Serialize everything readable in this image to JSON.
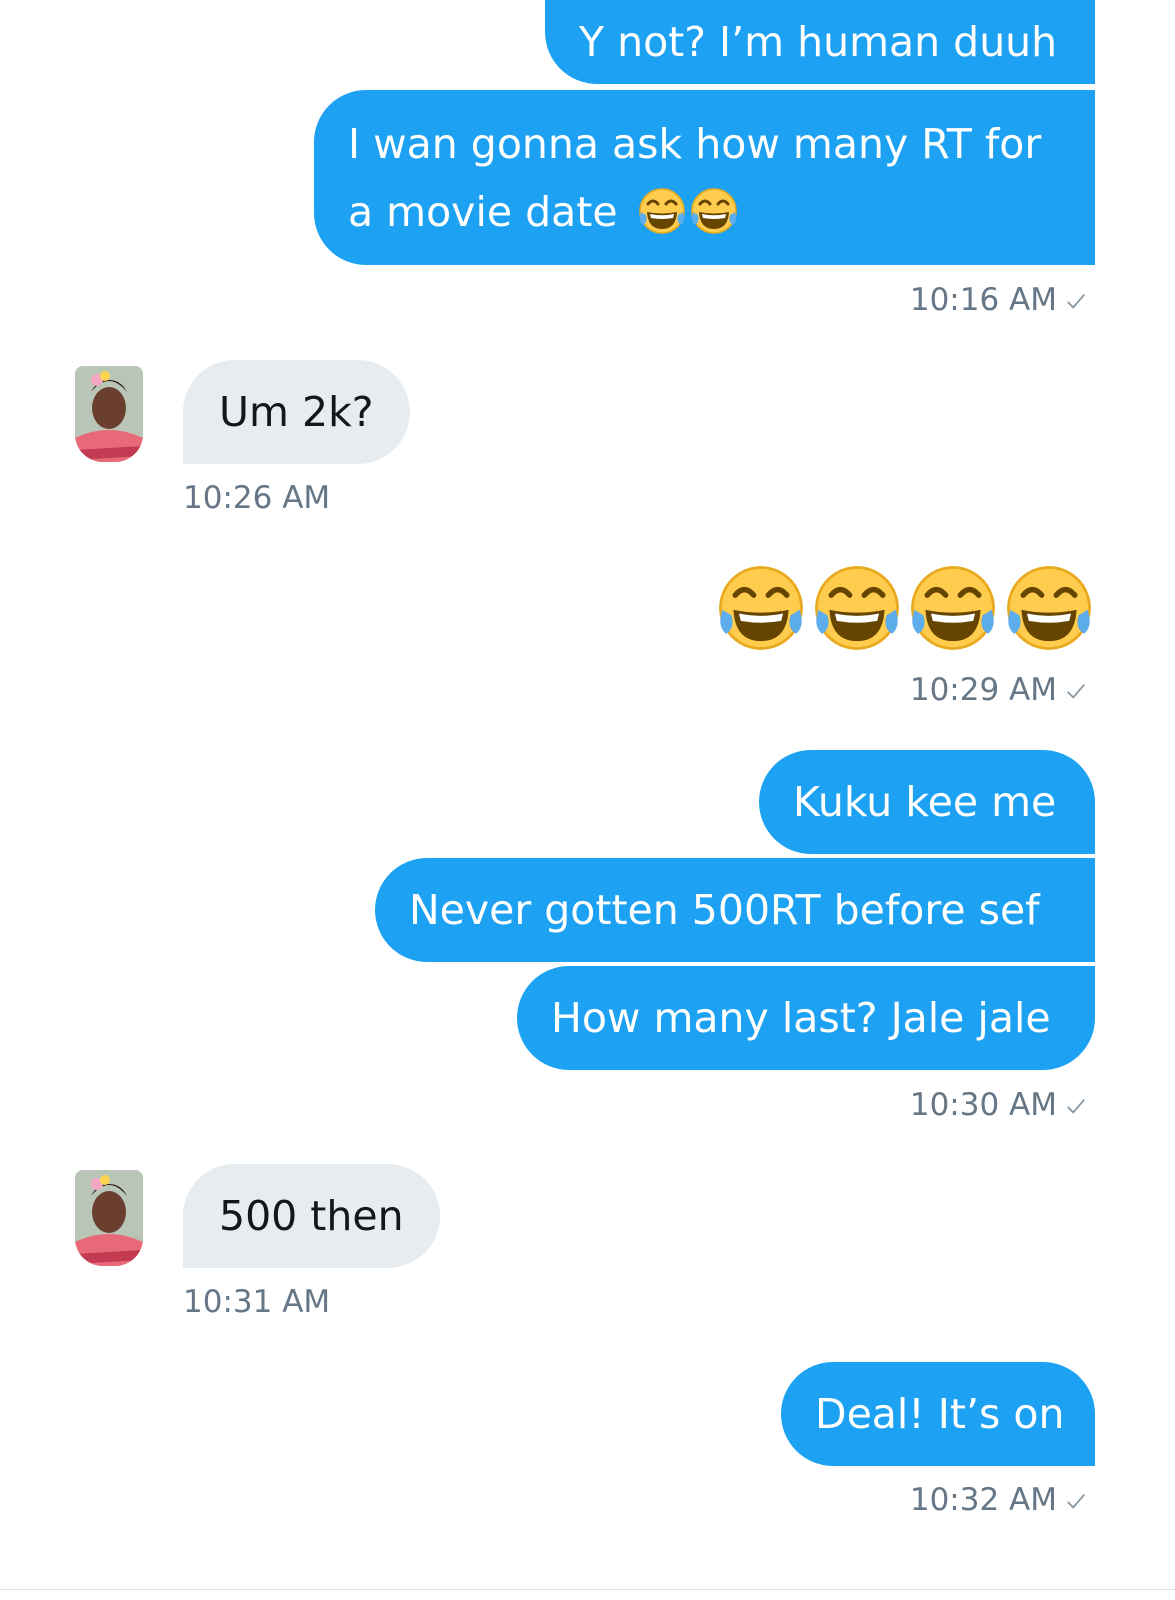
{
  "messages": {
    "m1": "Y not? I’m human duuh",
    "m2_line1": "I wan gonna ask how many RT for",
    "m2_line2": "a movie date",
    "t1": "10:16 AM",
    "r1": "Um 2k?",
    "rt1": "10:26 AM",
    "t2": "10:29 AM",
    "m3": "Kuku kee me",
    "m4": "Never gotten 500RT before sef",
    "m5": "How many last? Jale jale",
    "t3": "10:30 AM",
    "r2": "500 then",
    "rt2": "10:31 AM",
    "m6": "Deal! It’s on",
    "t4": "10:32 AM"
  },
  "icons": {
    "emoji": "face-with-tears-of-joy",
    "read_receipt": "check-icon"
  },
  "colors": {
    "outgoing_bubble": "#1da1f2",
    "incoming_bubble": "#e6ecf0",
    "timestamp": "#657786"
  }
}
